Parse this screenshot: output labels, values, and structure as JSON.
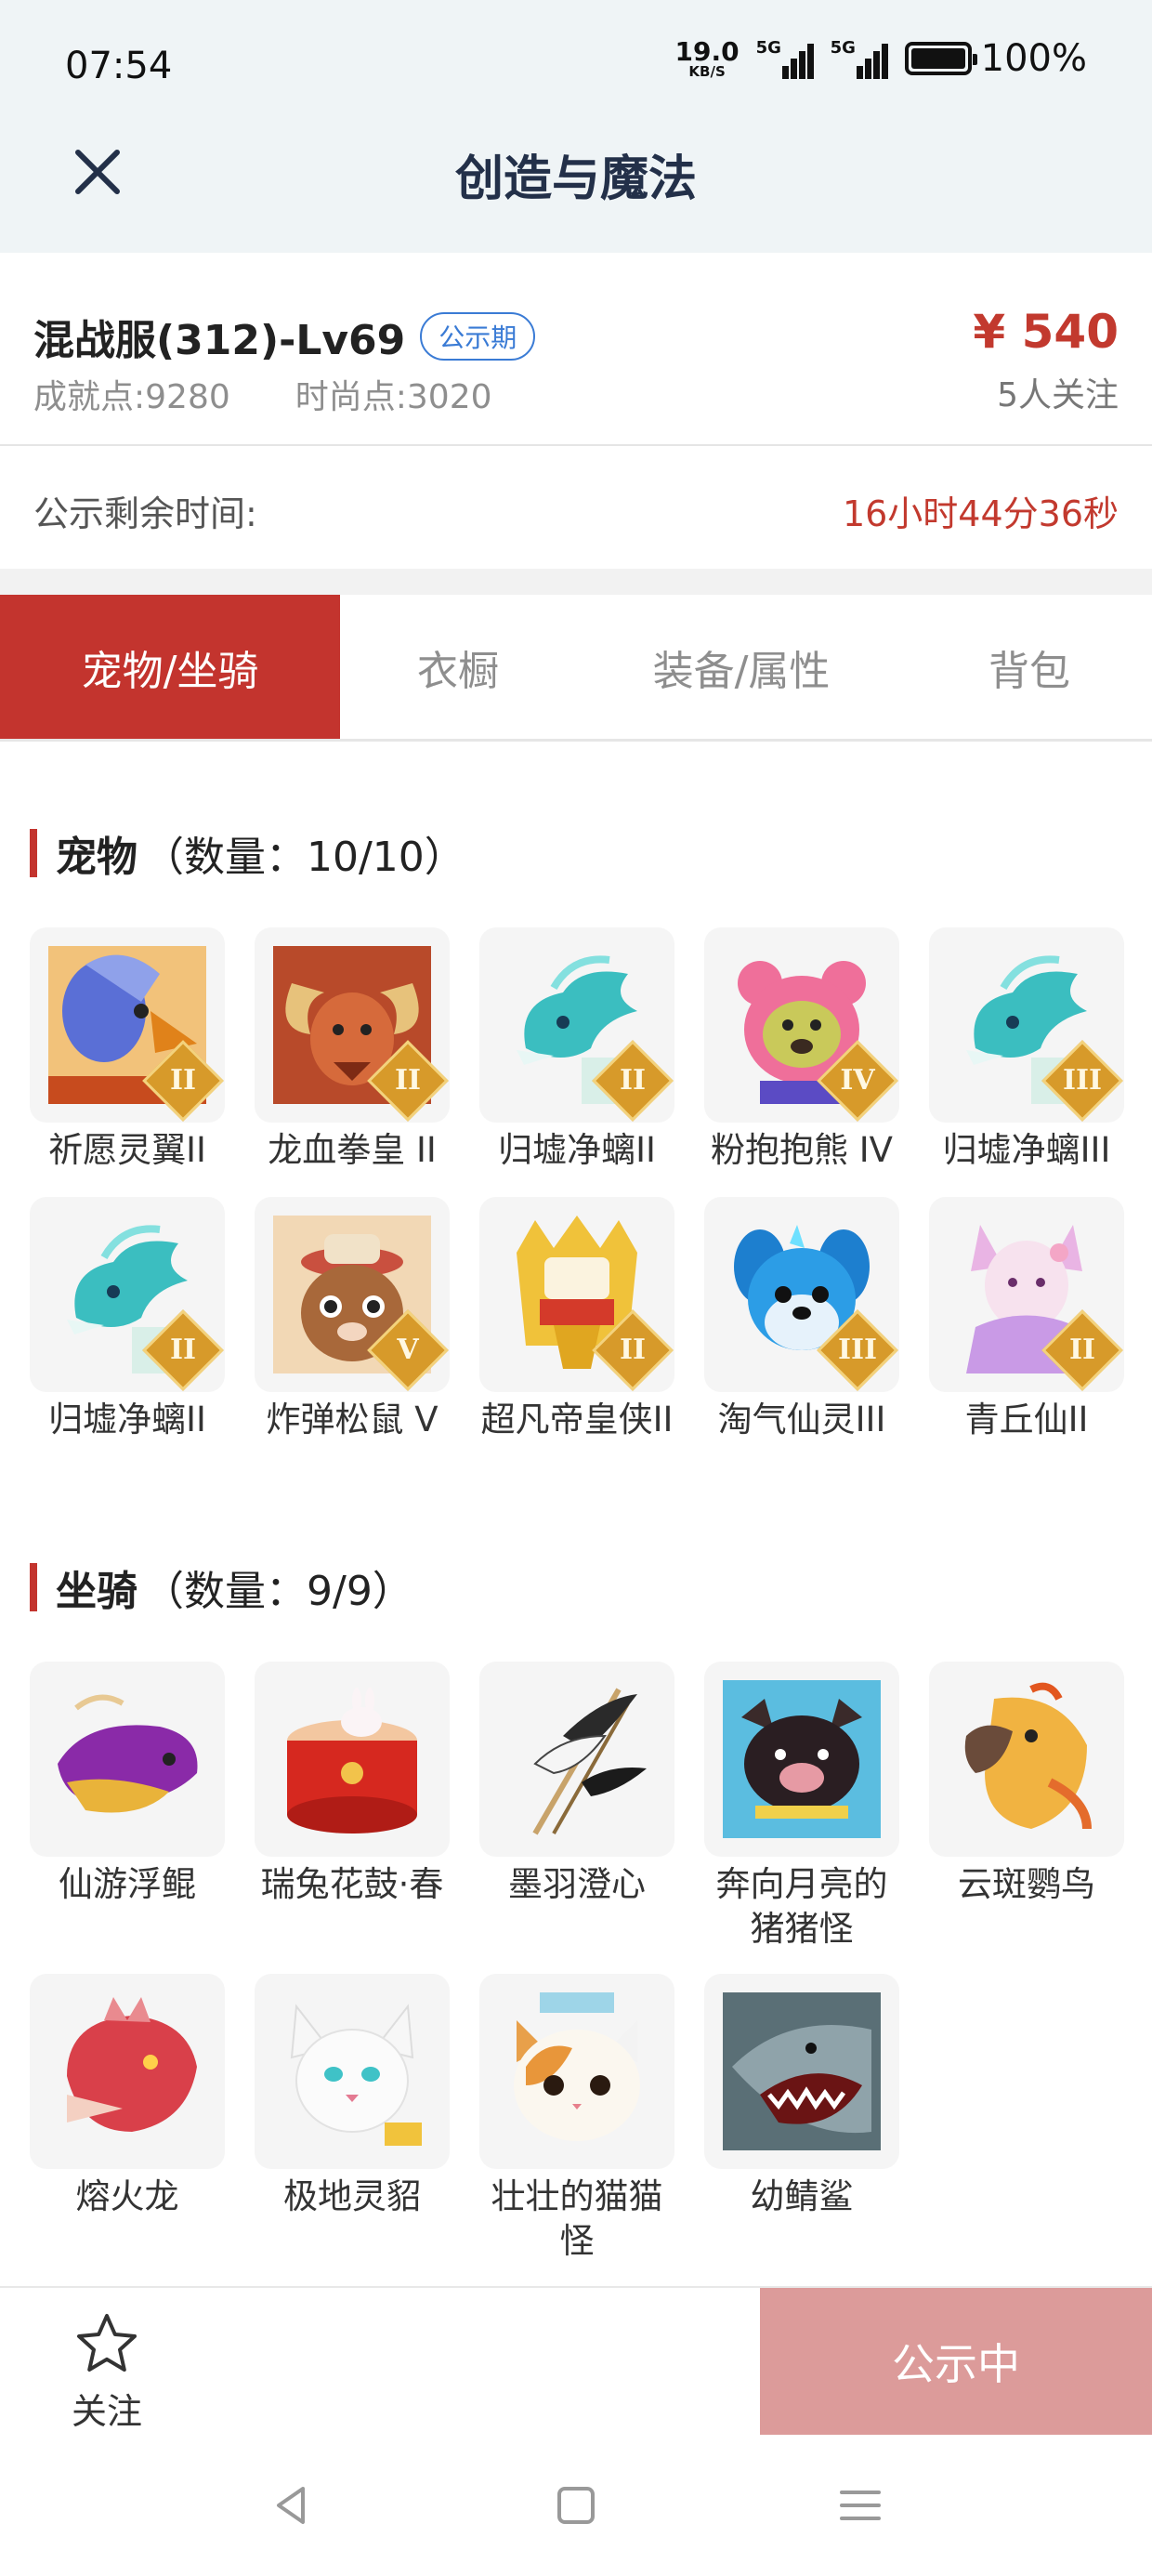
{
  "status_bar": {
    "time": "07:54",
    "net_speed": "19.0",
    "net_unit": "KB/S",
    "sim1": "5G",
    "sim2": "5G",
    "battery": "100%"
  },
  "header": {
    "title": "创造与魔法"
  },
  "listing": {
    "server": "混战服(312)-Lv69",
    "phase_badge": "公示期",
    "achievement_label": "成就点:",
    "achievement_value": "9280",
    "fashion_label": "时尚点:",
    "fashion_value": "3020",
    "price": "¥ 540",
    "followers": "5人关注",
    "countdown_label": "公示剩余时间:",
    "countdown_value": "16小时44分36秒"
  },
  "tabs": [
    {
      "label": "宠物/坐骑",
      "active": true
    },
    {
      "label": "衣橱",
      "active": false
    },
    {
      "label": "装备/属性",
      "active": false
    },
    {
      "label": "背包",
      "active": false
    }
  ],
  "pets": {
    "title": "宠物",
    "count": "（数量：10/10）",
    "items": [
      {
        "name": "祈愿灵翼II",
        "grade": "II",
        "icon": "griffin-icon"
      },
      {
        "name": "龙血拳皇 II",
        "grade": "II",
        "icon": "horned-beast-icon"
      },
      {
        "name": "归墟净螭II",
        "grade": "II",
        "icon": "azure-dragon-icon"
      },
      {
        "name": "粉抱抱熊 IV",
        "grade": "IV",
        "icon": "pink-bear-icon"
      },
      {
        "name": "归墟净螭III",
        "grade": "III",
        "icon": "azure-dragon-icon"
      },
      {
        "name": "归墟净螭II",
        "grade": "II",
        "icon": "azure-dragon-icon"
      },
      {
        "name": "炸弹松鼠 V",
        "grade": "V",
        "icon": "squirrel-icon"
      },
      {
        "name": "超凡帝皇侠II",
        "grade": "II",
        "icon": "golden-hero-icon"
      },
      {
        "name": "淘气仙灵III",
        "grade": "III",
        "icon": "blue-pup-icon"
      },
      {
        "name": "青丘仙II",
        "grade": "II",
        "icon": "fox-fairy-icon"
      }
    ]
  },
  "mounts": {
    "title": "坐骑",
    "count": "（数量：9/9）",
    "items": [
      {
        "name": "仙游浮鲲",
        "icon": "flying-fish-icon"
      },
      {
        "name": "瑞兔花鼓·春",
        "icon": "rabbit-drum-icon"
      },
      {
        "name": "墨羽澄心",
        "icon": "ink-feather-icon"
      },
      {
        "name": "奔向月亮的猪猪怪",
        "icon": "pig-icon"
      },
      {
        "name": "云斑鹦鸟",
        "icon": "parrot-icon"
      },
      {
        "name": "熔火龙",
        "icon": "fire-dragon-icon"
      },
      {
        "name": "极地灵貂",
        "icon": "white-fox-icon"
      },
      {
        "name": "壮壮的猫猫怪",
        "icon": "cat-icon"
      },
      {
        "name": "幼鲭鲨",
        "icon": "shark-icon"
      }
    ]
  },
  "bottom": {
    "follow_label": "关注",
    "status_button": "公示中"
  },
  "colors": {
    "accent": "#c3342e",
    "price": "#c2392e",
    "badge_blue": "#3a7bd5",
    "status_button": "#dc9b9a"
  }
}
